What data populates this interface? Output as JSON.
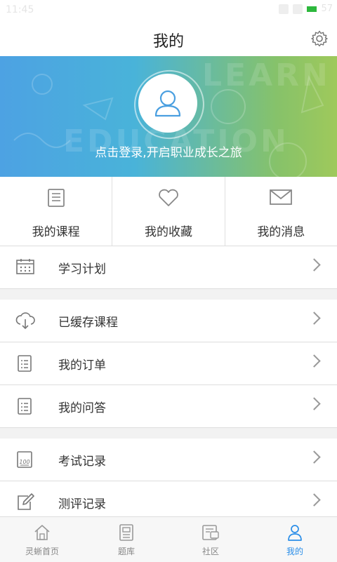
{
  "status_bar": {
    "time": "11:45",
    "battery": "57"
  },
  "header": {
    "title": "我的",
    "settings_icon": "gear-icon"
  },
  "banner": {
    "login_text": "点击登录,开启职业成长之旅",
    "deco_word_1": "LEARN",
    "deco_word_2": "EDUCATION"
  },
  "quick_actions": [
    {
      "label": "我的课程",
      "icon": "course-book-icon"
    },
    {
      "label": "我的收藏",
      "icon": "heart-icon"
    },
    {
      "label": "我的消息",
      "icon": "mail-icon"
    }
  ],
  "menu": [
    {
      "label": "学习计划",
      "icon": "calendar-icon"
    },
    {
      "label": "已缓存课程",
      "icon": "cloud-download-icon"
    },
    {
      "label": "我的订单",
      "icon": "order-list-icon"
    },
    {
      "label": "我的问答",
      "icon": "qa-list-icon"
    },
    {
      "label": "考试记录",
      "icon": "exam-score-icon"
    },
    {
      "label": "测评记录",
      "icon": "edit-record-icon"
    }
  ],
  "tabs": [
    {
      "label": "灵蜥首页",
      "icon": "home-icon",
      "active": false
    },
    {
      "label": "题库",
      "icon": "question-bank-icon",
      "active": false
    },
    {
      "label": "社区",
      "icon": "community-icon",
      "active": false
    },
    {
      "label": "我的",
      "icon": "profile-icon",
      "active": true
    }
  ],
  "colors": {
    "accent": "#2b8ee8",
    "banner_start": "#4da2e3",
    "banner_end": "#9fc95b",
    "divider": "#dddddd",
    "background": "#f2f2f2"
  }
}
